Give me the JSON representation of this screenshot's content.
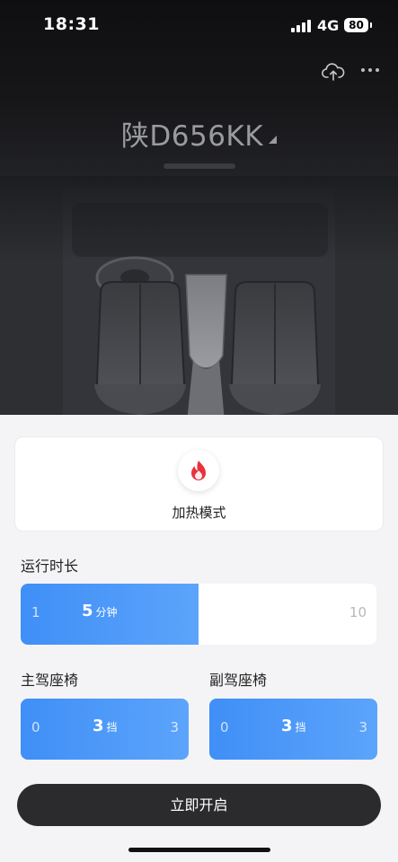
{
  "status_bar": {
    "time": "18:31",
    "network": "4G",
    "battery": "80"
  },
  "header": {
    "plate": "陕D656KK",
    "upload_icon": "cloud-upload-icon",
    "more_icon": "more-icon"
  },
  "mode": {
    "label": "加热模式",
    "icon": "flame-icon",
    "icon_color": "#e8323c"
  },
  "duration": {
    "title": "运行时长",
    "min": "1",
    "max": "10",
    "value": "5",
    "unit": "分钟",
    "fraction": 0.5
  },
  "driver_seat": {
    "title": "主驾座椅",
    "min": "0",
    "max": "3",
    "value": "3",
    "unit": "挡"
  },
  "passenger_seat": {
    "title": "副驾座椅",
    "min": "0",
    "max": "3",
    "value": "3",
    "unit": "挡"
  },
  "start_button": {
    "label": "立即开启"
  },
  "colors": {
    "accent": "#4796f8",
    "button_dark": "#2b2b2e",
    "background": "#f4f4f6"
  }
}
